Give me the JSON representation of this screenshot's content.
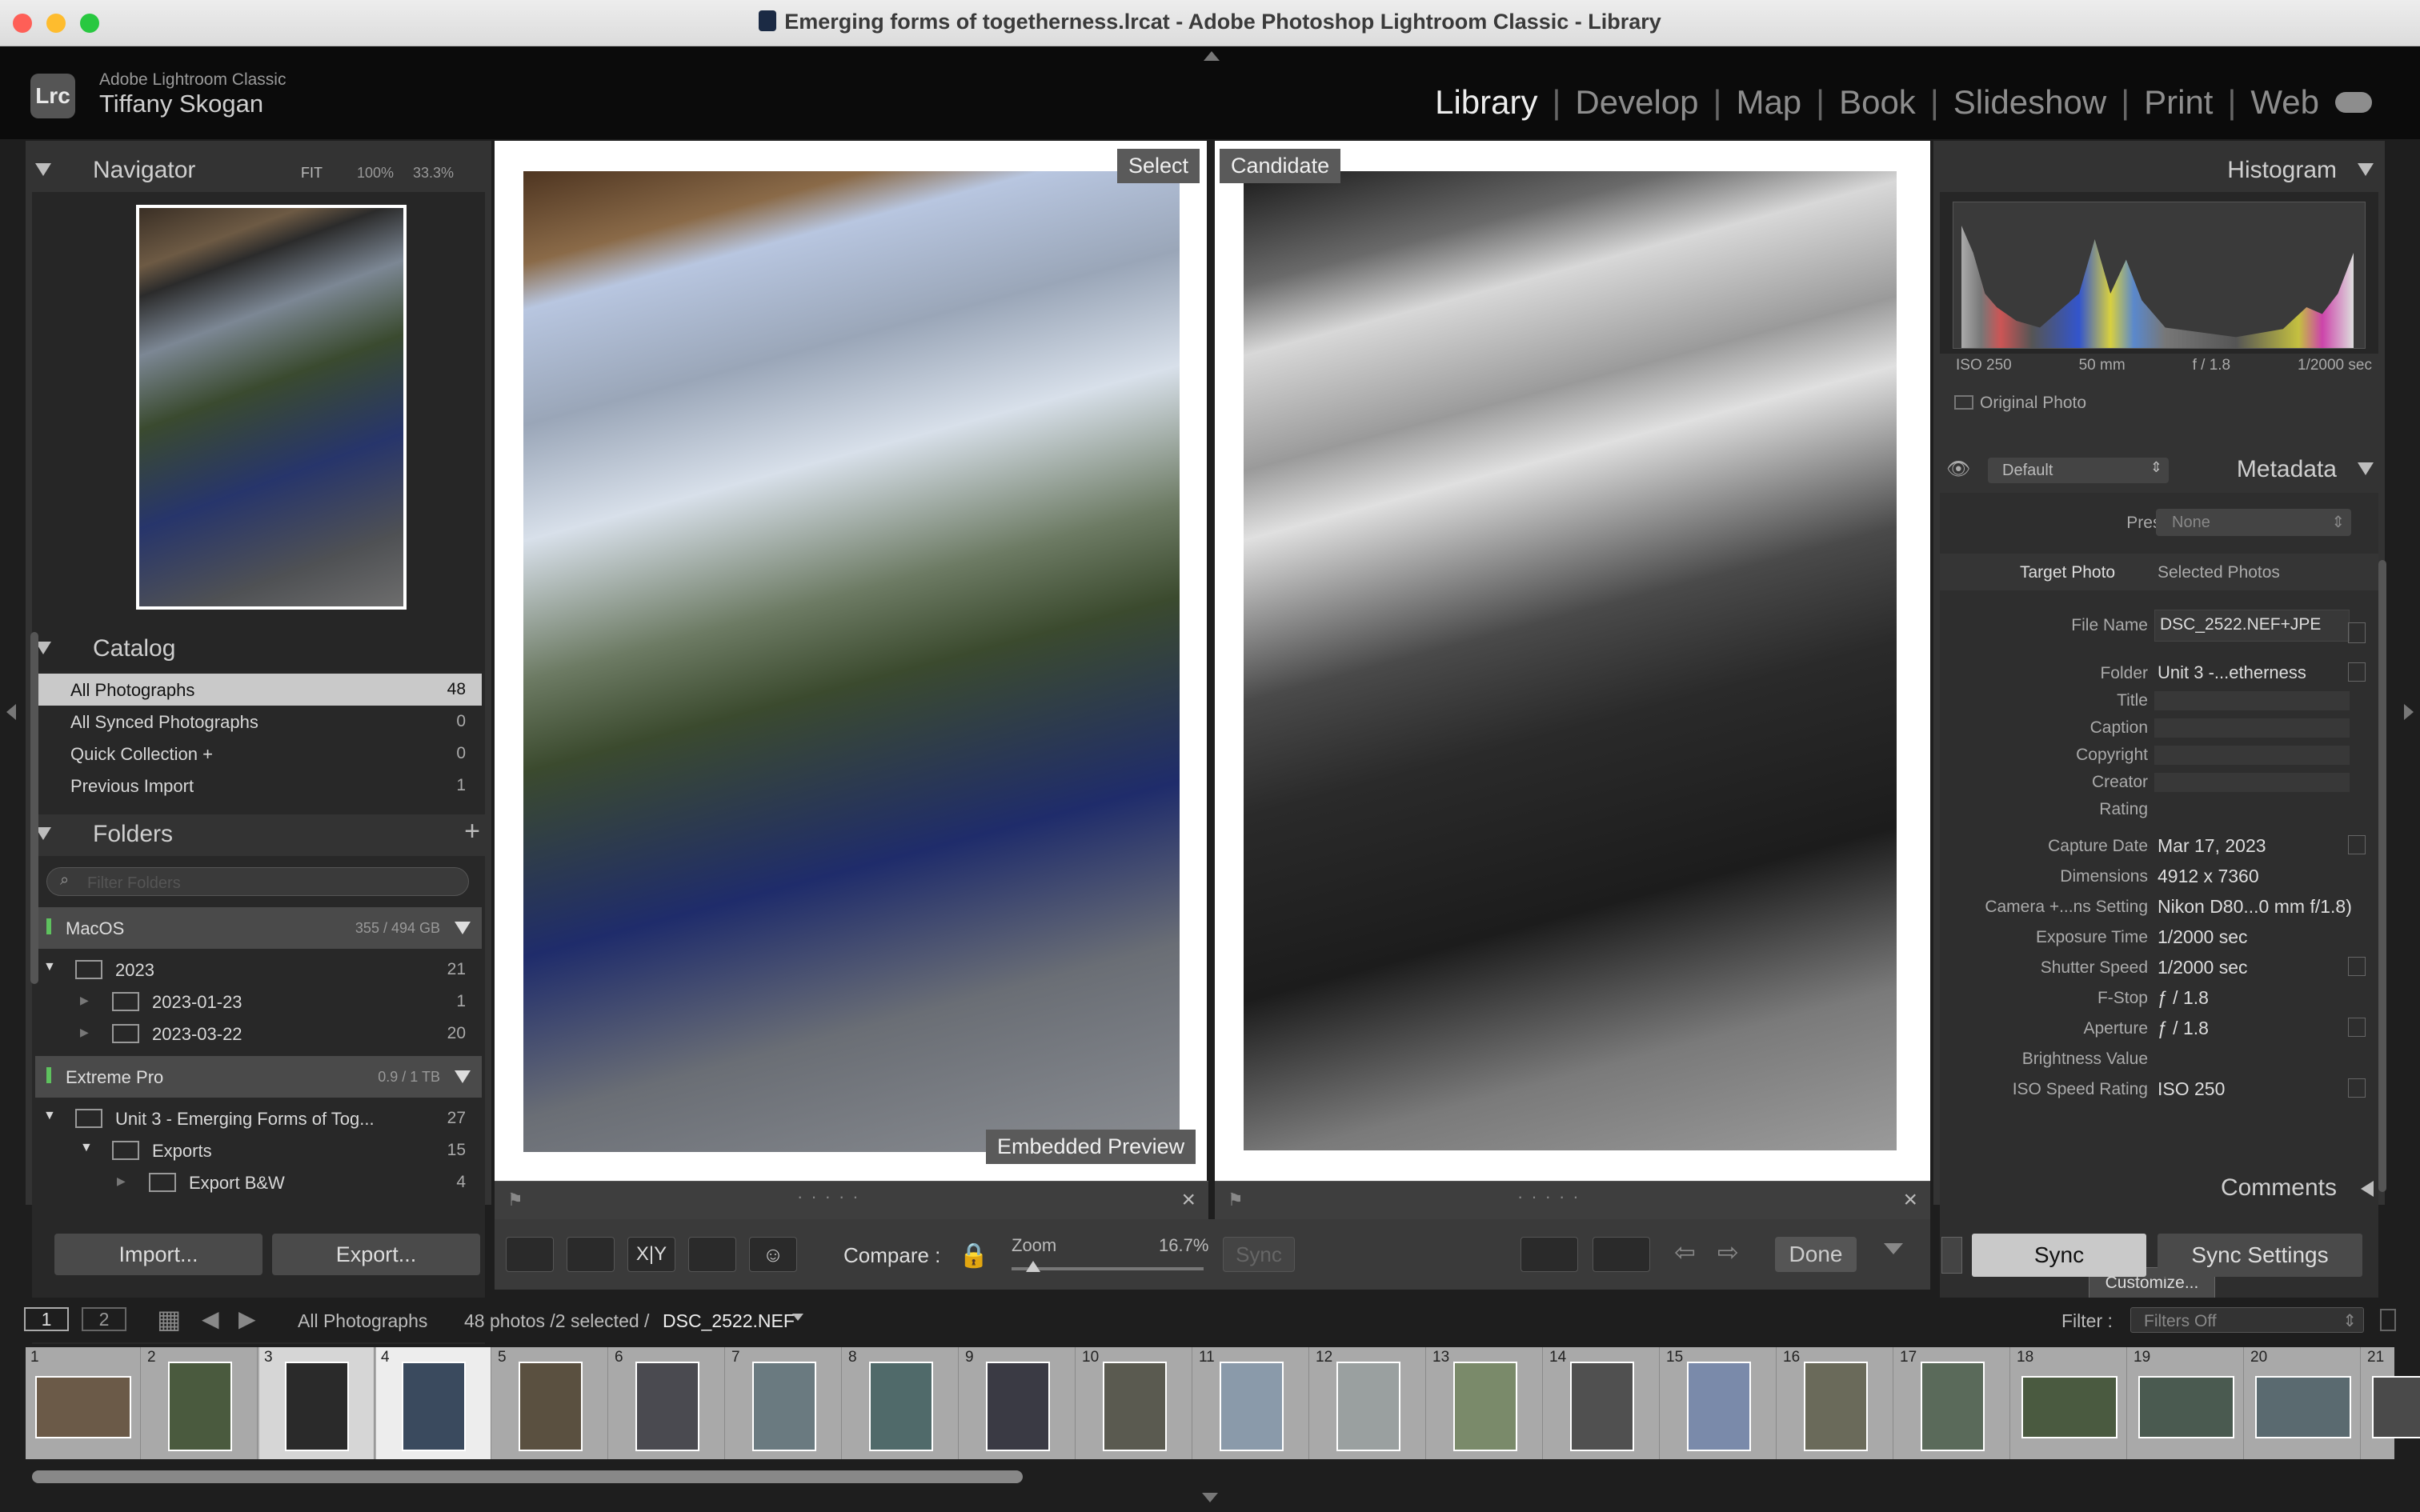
{
  "window": {
    "title": "Emerging forms of togetherness.lrcat - Adobe Photoshop Lightroom Classic - Library"
  },
  "identity": {
    "logo": "Lrc",
    "app": "Adobe Lightroom Classic",
    "user": "Tiffany Skogan"
  },
  "modules": [
    "Library",
    "Develop",
    "Map",
    "Book",
    "Slideshow",
    "Print",
    "Web"
  ],
  "active_module": "Library",
  "navigator": {
    "title": "Navigator",
    "zoom_options": [
      "FIT",
      "100%",
      "33.3%"
    ]
  },
  "catalog": {
    "title": "Catalog",
    "items": [
      {
        "label": "All Photographs",
        "count": "48"
      },
      {
        "label": "All Synced Photographs",
        "count": "0"
      },
      {
        "label": "Quick Collection +",
        "count": "0"
      },
      {
        "label": "Previous Import",
        "count": "1"
      }
    ]
  },
  "folders": {
    "title": "Folders",
    "filter_placeholder": "Filter Folders",
    "volumes": [
      {
        "name": "MacOS",
        "size": "355 / 494 GB"
      },
      {
        "name": "Extreme Pro",
        "size": "0.9 / 1 TB"
      }
    ],
    "tree": [
      {
        "name": "2023",
        "count": "21"
      },
      {
        "name": "2023-01-23",
        "count": "1"
      },
      {
        "name": "2023-03-22",
        "count": "20"
      },
      {
        "name": "Unit 3 - Emerging Forms of Tog...",
        "count": "27"
      },
      {
        "name": "Exports",
        "count": "15"
      },
      {
        "name": "Export B&W",
        "count": "4"
      }
    ]
  },
  "left_buttons": {
    "import": "Import...",
    "export": "Export..."
  },
  "compare": {
    "select_label": "Select",
    "candidate_label": "Candidate",
    "preview_label": "Embedded Preview"
  },
  "toolbar": {
    "compare_label": "Compare :",
    "zoom_label": "Zoom",
    "zoom_value": "16.7%",
    "sync": "Sync",
    "done": "Done",
    "xy": "X|Y"
  },
  "histogram": {
    "title": "Histogram",
    "iso": "ISO 250",
    "focal": "50 mm",
    "fstop": "f / 1.8",
    "shutter": "1/2000 sec",
    "original": "Original Photo"
  },
  "metadata": {
    "title": "Metadata",
    "preset_set": "Default",
    "preset_label": "Preset",
    "preset_value": "None",
    "tabs": [
      "Target Photo",
      "Selected Photos"
    ],
    "fields": [
      {
        "label": "File Name",
        "value": "DSC_2522.NEF+JPE"
      },
      {
        "label": "Folder",
        "value": "Unit 3 -...etherness"
      },
      {
        "label": "Title",
        "value": ""
      },
      {
        "label": "Caption",
        "value": ""
      },
      {
        "label": "Copyright",
        "value": ""
      },
      {
        "label": "Creator",
        "value": ""
      },
      {
        "label": "Rating",
        "value": ""
      },
      {
        "label": "Capture Date",
        "value": "Mar 17, 2023"
      },
      {
        "label": "Dimensions",
        "value": "4912 x 7360"
      },
      {
        "label": "Camera +...ns Setting",
        "value": "Nikon D80...0 mm f/1.8)"
      },
      {
        "label": "Exposure Time",
        "value": "1/2000 sec"
      },
      {
        "label": "Shutter Speed",
        "value": "1/2000 sec"
      },
      {
        "label": "F-Stop",
        "value": "ƒ / 1.8"
      },
      {
        "label": "Aperture",
        "value": "ƒ / 1.8"
      },
      {
        "label": "Brightness Value",
        "value": ""
      },
      {
        "label": "ISO Speed Rating",
        "value": "ISO 250"
      }
    ],
    "customize": "Customize..."
  },
  "comments": {
    "title": "Comments"
  },
  "right_buttons": {
    "sync": "Sync",
    "sync_settings": "Sync Settings"
  },
  "filmstrip": {
    "page1": "1",
    "page2": "2",
    "source": "All Photographs",
    "info": "48 photos /2 selected /",
    "current": "DSC_2522.NEF",
    "filter_label": "Filter :",
    "filter_value": "Filters Off",
    "cells": [
      "1",
      "2",
      "3",
      "4",
      "5",
      "6",
      "7",
      "8",
      "9",
      "10",
      "11",
      "12",
      "13",
      "14",
      "15",
      "16",
      "17",
      "18",
      "19",
      "20",
      "21"
    ]
  }
}
